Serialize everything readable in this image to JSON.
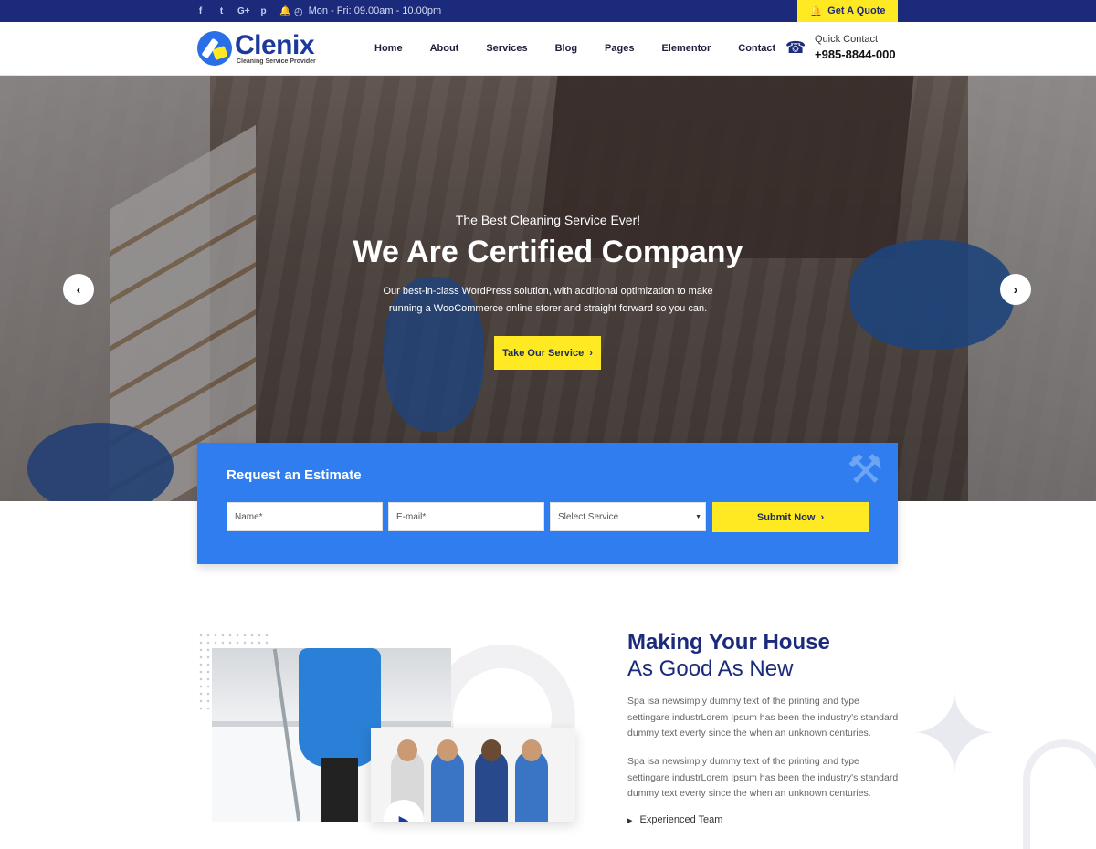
{
  "topbar": {
    "socials": [
      "f",
      "t",
      "G+",
      "p",
      "b"
    ],
    "social_icons": [
      "facebook-icon",
      "twitter-icon",
      "google-plus-icon",
      "pinterest-icon",
      "bell-icon"
    ],
    "hours": "Mon - Fri: 09.00am - 10.00pm",
    "quote_button": "Get A Quote"
  },
  "brand": {
    "name": "Clenix",
    "tagline": "Cleaning Service Provider"
  },
  "nav": {
    "items": [
      "Home",
      "About",
      "Services",
      "Blog",
      "Pages",
      "Elementor",
      "Contact"
    ]
  },
  "contact": {
    "label": "Quick Contact",
    "phone": "+985-8844-000"
  },
  "hero": {
    "pretitle": "The Best Cleaning Service Ever!",
    "title": "We Are Certified Company",
    "description": "Our best-in-class WordPress solution, with additional optimization to make running a WooCommerce online storer and straight forward so you can.",
    "cta": "Take Our Service"
  },
  "estimate": {
    "title": "Request an Estimate",
    "name_placeholder": "Name*",
    "email_placeholder": "E-mail*",
    "service_select": "Slelect Service",
    "submit": "Submit Now"
  },
  "about": {
    "title": "Making Your House",
    "subtitle": "As Good As New",
    "paragraph1": "Spa isa newsimply dummy text of the printing and type settingare industrLorem Ipsum has been the industry's standard dummy text everty since the when an unknown centuries.",
    "paragraph2": "Spa isa newsimply dummy text of the printing and type settingare industrLorem Ipsum has been the industry's standard dummy text everty since the when an unknown centuries.",
    "list_item": "Experienced Team"
  },
  "colors": {
    "navy": "#1b2a7b",
    "blue": "#2f7def",
    "yellow": "#ffe923"
  }
}
